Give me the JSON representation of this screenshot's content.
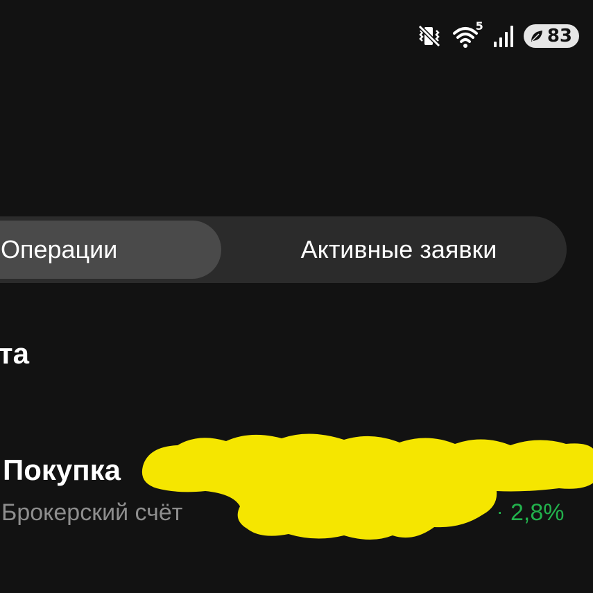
{
  "status_bar": {
    "icons": [
      "vibrate-mute-icon",
      "wifi-icon",
      "signal-icon"
    ],
    "wifi_badge": "5",
    "battery_level": "83",
    "battery_icon": "leaf-icon"
  },
  "tabs": [
    {
      "label": "Операции",
      "selected": true
    },
    {
      "label": "Активные заявки",
      "selected": false
    }
  ],
  "section_heading": "та",
  "operation": {
    "title": "Покупка",
    "account": "Брокерский счёт",
    "change_percent": "2,8%"
  },
  "colors": {
    "background": "#121212",
    "tabs_track": "#2b2b2b",
    "tab_selected": "#4a4a4a",
    "positive": "#22b14c",
    "muted_text": "#8e8e8e",
    "redaction": "#f5e600"
  }
}
